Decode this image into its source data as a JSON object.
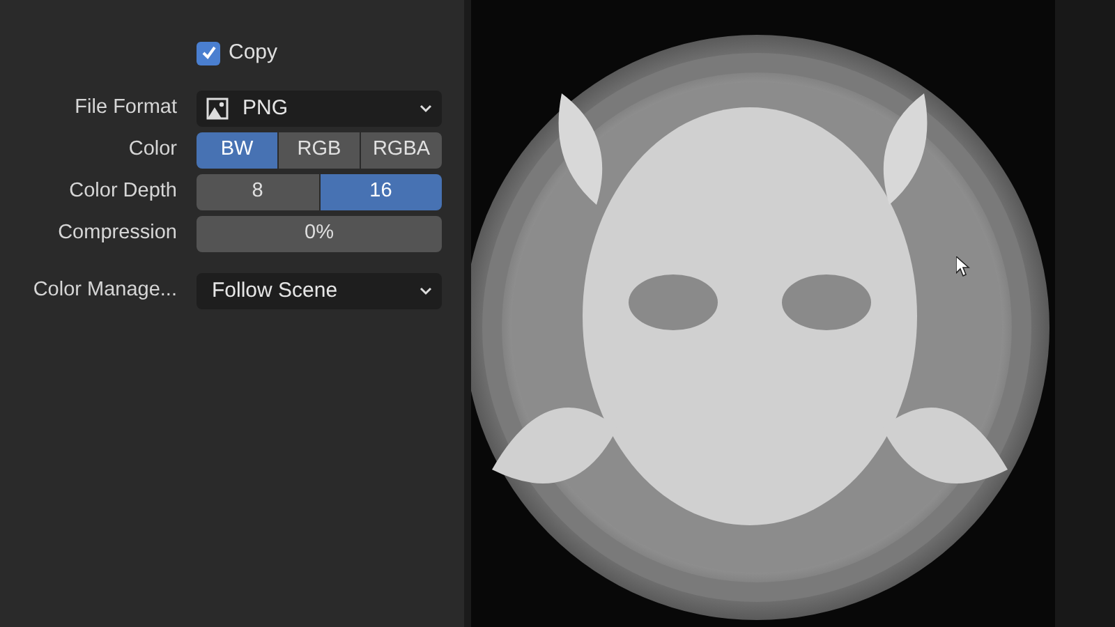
{
  "copy": {
    "label": "Copy",
    "checked": true
  },
  "fields": [
    {
      "kind": "dropdown",
      "label": "File Format",
      "value": "PNG",
      "has_icon": true
    },
    {
      "kind": "toggle",
      "label": "Color",
      "options": [
        {
          "label": "BW",
          "selected": true
        },
        {
          "label": "RGB",
          "selected": false
        },
        {
          "label": "RGBA",
          "selected": false
        }
      ]
    },
    {
      "kind": "toggle",
      "label": "Color Depth",
      "options": [
        {
          "label": "8",
          "selected": false
        },
        {
          "label": "16",
          "selected": true
        }
      ]
    },
    {
      "kind": "slider",
      "label": "Compression",
      "value": "0%",
      "level": 0
    },
    {
      "kind": "dropdown",
      "label": "Color Manage...",
      "value": "Follow Scene",
      "has_icon": false
    }
  ]
}
